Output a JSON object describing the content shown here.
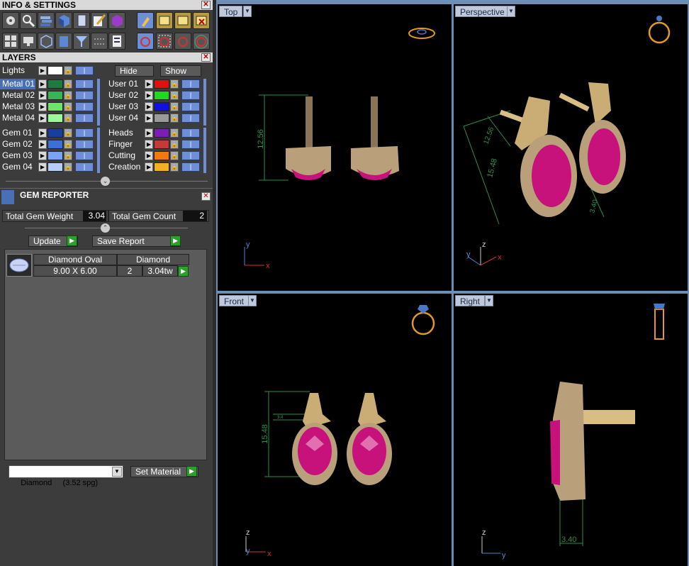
{
  "info_panel": {
    "title": "INFO & SETTINGS",
    "close": "✕"
  },
  "layers_panel": {
    "title": "LAYERS",
    "close": "✕",
    "lights": "Lights",
    "hide": "Hide",
    "show": "Show",
    "left_layers": [
      {
        "name": "Metal 01",
        "color": "#1f7a3e"
      },
      {
        "name": "Metal 02",
        "color": "#3ab257"
      },
      {
        "name": "Metal 03",
        "color": "#6ee26b"
      },
      {
        "name": "Metal 04",
        "color": "#9ff59a"
      },
      {
        "name": "Gem 01",
        "color": "#1a3f9a"
      },
      {
        "name": "Gem 02",
        "color": "#3d6fd6"
      },
      {
        "name": "Gem 03",
        "color": "#7aa4f2"
      },
      {
        "name": "Gem 04",
        "color": "#b6cdf7"
      }
    ],
    "right_layers": [
      {
        "name": "User 01",
        "color": "#e01010"
      },
      {
        "name": "User 02",
        "color": "#1fd81f"
      },
      {
        "name": "User 03",
        "color": "#1010e0"
      },
      {
        "name": "User 04",
        "color": "#9a9a9a"
      },
      {
        "name": "Heads",
        "color": "#7a1fb0"
      },
      {
        "name": "Finger",
        "color": "#c43a3a"
      },
      {
        "name": "Cutting",
        "color": "#f07a10"
      },
      {
        "name": "Creation",
        "color": "#f0b020"
      }
    ]
  },
  "gem_reporter": {
    "title": "GEM REPORTER",
    "close": "✕",
    "total_weight_label": "Total Gem Weight",
    "total_weight": "3.04",
    "total_count_label": "Total Gem Count",
    "total_count": "2",
    "update": "Update",
    "save_report": "Save Report",
    "gem_row": {
      "shape": "Diamond Oval",
      "material": "Diamond",
      "size": "9.00 X 6.00",
      "count": "2",
      "weight": "3.04tw"
    },
    "material_select": "Diamond     (3.52 spg)",
    "set_material": "Set Material"
  },
  "viewports": {
    "top": {
      "label": "Top",
      "dim": "12.56"
    },
    "perspective": {
      "label": "Perspective",
      "dim1": "12.56",
      "dim2": "15.48",
      "dim3": "3.40"
    },
    "front": {
      "label": "Front",
      "dim": "15.48",
      "dim_small": "3.4"
    },
    "right": {
      "label": "Right",
      "dim": "3.40"
    }
  },
  "axes": {
    "x": "x",
    "y": "y",
    "z": "z"
  },
  "colors": {
    "gold": "#d9be84",
    "ruby": "#c6127a",
    "dimension": "#2e8f4c",
    "view_bg": "#000000"
  }
}
